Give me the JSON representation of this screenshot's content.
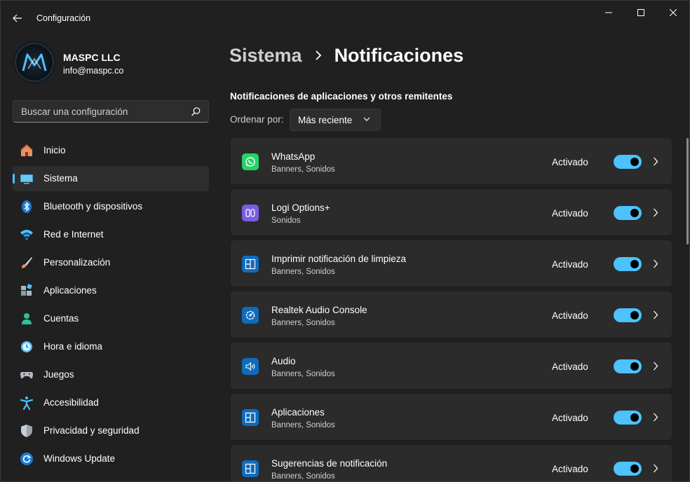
{
  "window": {
    "title": "Configuración"
  },
  "profile": {
    "name": "MASPC LLC",
    "email": "info@maspc.co"
  },
  "search": {
    "placeholder": "Buscar una configuración"
  },
  "sidebar": {
    "items": [
      {
        "label": "Inicio",
        "icon": "home-icon",
        "active": false
      },
      {
        "label": "Sistema",
        "icon": "system-icon",
        "active": true
      },
      {
        "label": "Bluetooth y dispositivos",
        "icon": "bluetooth-icon",
        "active": false
      },
      {
        "label": "Red e Internet",
        "icon": "wifi-icon",
        "active": false
      },
      {
        "label": "Personalización",
        "icon": "brush-icon",
        "active": false
      },
      {
        "label": "Aplicaciones",
        "icon": "apps-icon",
        "active": false
      },
      {
        "label": "Cuentas",
        "icon": "account-icon",
        "active": false
      },
      {
        "label": "Hora e idioma",
        "icon": "time-language-icon",
        "active": false
      },
      {
        "label": "Juegos",
        "icon": "gamepad-icon",
        "active": false
      },
      {
        "label": "Accesibilidad",
        "icon": "accessibility-icon",
        "active": false
      },
      {
        "label": "Privacidad y seguridad",
        "icon": "shield-icon",
        "active": false
      },
      {
        "label": "Windows Update",
        "icon": "update-icon",
        "active": false
      }
    ]
  },
  "breadcrumb": {
    "parent": "Sistema",
    "current": "Notificaciones"
  },
  "section": {
    "title": "Notificaciones de aplicaciones y otros remitentes",
    "sort_label": "Ordenar por:",
    "sort_value": "Más reciente"
  },
  "apps": [
    {
      "name": "WhatsApp",
      "sub": "Banners, Sonidos",
      "state": "Activado",
      "on": true,
      "icon": "whatsapp-icon"
    },
    {
      "name": "Logi Options+",
      "sub": "Sonidos",
      "state": "Activado",
      "on": true,
      "icon": "logi-options-icon"
    },
    {
      "name": "Imprimir notificación de limpieza",
      "sub": "Banners, Sonidos",
      "state": "Activado",
      "on": true,
      "icon": "generic-app-icon"
    },
    {
      "name": "Realtek Audio Console",
      "sub": "Banners, Sonidos",
      "state": "Activado",
      "on": true,
      "icon": "realtek-icon"
    },
    {
      "name": "Audio",
      "sub": "Banners, Sonidos",
      "state": "Activado",
      "on": true,
      "icon": "speaker-icon"
    },
    {
      "name": "Aplicaciones",
      "sub": "Banners, Sonidos",
      "state": "Activado",
      "on": true,
      "icon": "generic-app-icon"
    },
    {
      "name": "Sugerencias de notificación",
      "sub": "Banners, Sonidos",
      "state": "Activado",
      "on": true,
      "icon": "generic-app-icon"
    }
  ],
  "colors": {
    "accent": "#4cc2ff",
    "background": "#202020",
    "card": "#2b2b2b"
  }
}
